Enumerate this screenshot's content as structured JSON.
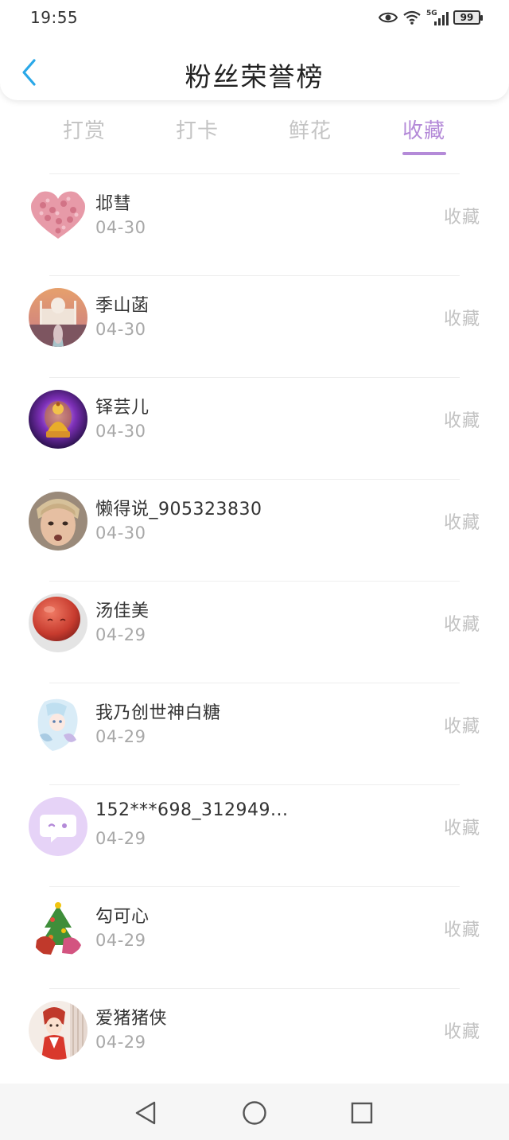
{
  "status_bar": {
    "time": "19:55",
    "network_label": "5G",
    "battery": "99",
    "icons": [
      "eye-icon",
      "wifi-icon",
      "signal-icon",
      "battery-icon"
    ]
  },
  "header": {
    "title": "粉丝荣誉榜",
    "back_icon": "chevron-left-icon"
  },
  "tabs": [
    {
      "label": "打赏",
      "active": false
    },
    {
      "label": "打卡",
      "active": false
    },
    {
      "label": "鲜花",
      "active": false
    },
    {
      "label": "收藏",
      "active": true
    }
  ],
  "colors": {
    "accent": "#b48ad8",
    "back": "#2aa8e8",
    "inactive_tab": "#c4c4c4"
  },
  "fans": [
    {
      "name": "邶彗",
      "date": "04-30",
      "action": "收藏",
      "avatar": "heart-roses"
    },
    {
      "name": "季山菡",
      "date": "04-30",
      "action": "收藏",
      "avatar": "taj-mahal"
    },
    {
      "name": "铎芸儿",
      "date": "04-30",
      "action": "收藏",
      "avatar": "golden-buddha"
    },
    {
      "name": "懒得说_905323830",
      "date": "04-30",
      "action": "收藏",
      "avatar": "person-photo"
    },
    {
      "name": "汤佳美",
      "date": "04-29",
      "action": "收藏",
      "avatar": "red-ball"
    },
    {
      "name": "我乃创世神白糖",
      "date": "04-29",
      "action": "收藏",
      "avatar": "anime-girl"
    },
    {
      "name": "152***698_312949...",
      "date": "04-29",
      "action": "收藏",
      "avatar": "default-chat"
    },
    {
      "name": "勾可心",
      "date": "04-29",
      "action": "收藏",
      "avatar": "christmas-tree"
    },
    {
      "name": "爱猪猪侠",
      "date": "04-29",
      "action": "收藏",
      "avatar": "cartoon-red"
    }
  ],
  "nav_bar": [
    "back-triangle-icon",
    "home-circle-icon",
    "recents-square-icon"
  ]
}
